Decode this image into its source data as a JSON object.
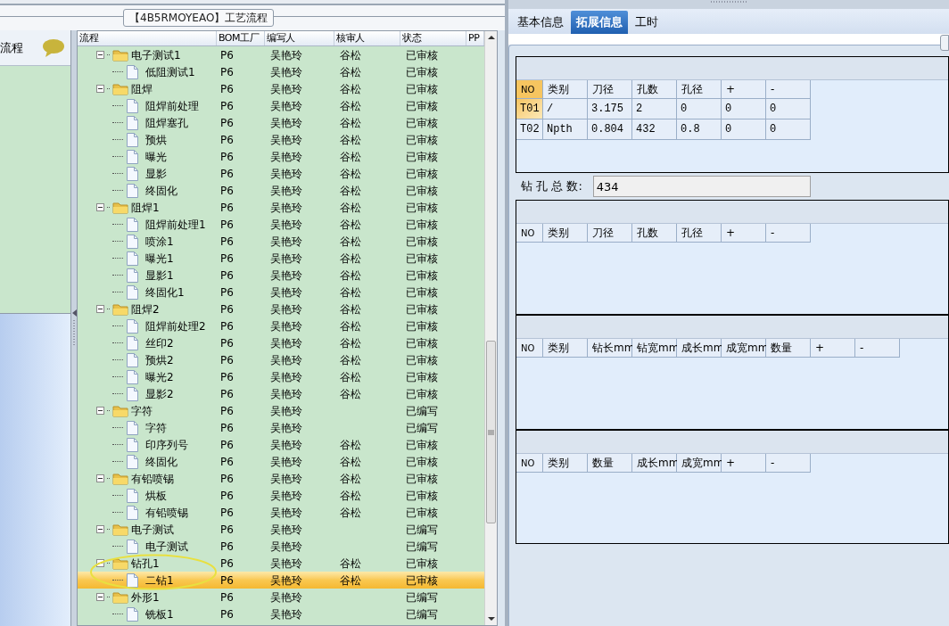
{
  "title_tab": "【4B5RMOYEAO】工艺流程",
  "left_panel": {
    "title": "流程"
  },
  "tree": {
    "columns": [
      "流程",
      "BOM工厂",
      "编写人",
      "核审人",
      "状态",
      "PP"
    ],
    "rows": [
      {
        "name": "电子测试1",
        "bom": "P6",
        "author": "吴艳玲",
        "reviewer": "谷松",
        "status": "已审核",
        "expanded": true,
        "selected": false,
        "children": [
          {
            "name": "低阻测试1",
            "bom": "P6",
            "author": "吴艳玲",
            "reviewer": "谷松",
            "status": "已审核",
            "selected": false
          }
        ]
      },
      {
        "name": "阻焊",
        "bom": "P6",
        "author": "吴艳玲",
        "reviewer": "谷松",
        "status": "已审核",
        "expanded": true,
        "selected": false,
        "children": [
          {
            "name": "阻焊前处理",
            "bom": "P6",
            "author": "吴艳玲",
            "reviewer": "谷松",
            "status": "已审核",
            "selected": false
          },
          {
            "name": "阻焊塞孔",
            "bom": "P6",
            "author": "吴艳玲",
            "reviewer": "谷松",
            "status": "已审核",
            "selected": false
          },
          {
            "name": "预烘",
            "bom": "P6",
            "author": "吴艳玲",
            "reviewer": "谷松",
            "status": "已审核",
            "selected": false
          },
          {
            "name": "曝光",
            "bom": "P6",
            "author": "吴艳玲",
            "reviewer": "谷松",
            "status": "已审核",
            "selected": false
          },
          {
            "name": "显影",
            "bom": "P6",
            "author": "吴艳玲",
            "reviewer": "谷松",
            "status": "已审核",
            "selected": false
          },
          {
            "name": "终固化",
            "bom": "P6",
            "author": "吴艳玲",
            "reviewer": "谷松",
            "status": "已审核",
            "selected": false
          }
        ]
      },
      {
        "name": "阻焊1",
        "bom": "P6",
        "author": "吴艳玲",
        "reviewer": "谷松",
        "status": "已审核",
        "expanded": true,
        "selected": false,
        "children": [
          {
            "name": "阻焊前处理1",
            "bom": "P6",
            "author": "吴艳玲",
            "reviewer": "谷松",
            "status": "已审核",
            "selected": false
          },
          {
            "name": "喷涂1",
            "bom": "P6",
            "author": "吴艳玲",
            "reviewer": "谷松",
            "status": "已审核",
            "selected": false
          },
          {
            "name": "曝光1",
            "bom": "P6",
            "author": "吴艳玲",
            "reviewer": "谷松",
            "status": "已审核",
            "selected": false
          },
          {
            "name": "显影1",
            "bom": "P6",
            "author": "吴艳玲",
            "reviewer": "谷松",
            "status": "已审核",
            "selected": false
          },
          {
            "name": "终固化1",
            "bom": "P6",
            "author": "吴艳玲",
            "reviewer": "谷松",
            "status": "已审核",
            "selected": false
          }
        ]
      },
      {
        "name": "阻焊2",
        "bom": "P6",
        "author": "吴艳玲",
        "reviewer": "谷松",
        "status": "已审核",
        "expanded": true,
        "selected": false,
        "children": [
          {
            "name": "阻焊前处理2",
            "bom": "P6",
            "author": "吴艳玲",
            "reviewer": "谷松",
            "status": "已审核",
            "selected": false
          },
          {
            "name": "丝印2",
            "bom": "P6",
            "author": "吴艳玲",
            "reviewer": "谷松",
            "status": "已审核",
            "selected": false
          },
          {
            "name": "预烘2",
            "bom": "P6",
            "author": "吴艳玲",
            "reviewer": "谷松",
            "status": "已审核",
            "selected": false
          },
          {
            "name": "曝光2",
            "bom": "P6",
            "author": "吴艳玲",
            "reviewer": "谷松",
            "status": "已审核",
            "selected": false
          },
          {
            "name": "显影2",
            "bom": "P6",
            "author": "吴艳玲",
            "reviewer": "谷松",
            "status": "已审核",
            "selected": false
          }
        ]
      },
      {
        "name": "字符",
        "bom": "P6",
        "author": "吴艳玲",
        "status": "已编写",
        "expanded": true,
        "selected": false,
        "children": [
          {
            "name": "字符",
            "bom": "P6",
            "author": "吴艳玲",
            "status": "已编写",
            "selected": false
          },
          {
            "name": "印序列号",
            "bom": "P6",
            "author": "吴艳玲",
            "reviewer": "谷松",
            "status": "已审核",
            "selected": false
          },
          {
            "name": "终固化",
            "bom": "P6",
            "author": "吴艳玲",
            "reviewer": "谷松",
            "status": "已审核",
            "selected": false
          }
        ]
      },
      {
        "name": "有铅喷锡",
        "bom": "P6",
        "author": "吴艳玲",
        "reviewer": "谷松",
        "status": "已审核",
        "expanded": true,
        "selected": false,
        "children": [
          {
            "name": "烘板",
            "bom": "P6",
            "author": "吴艳玲",
            "reviewer": "谷松",
            "status": "已审核",
            "selected": false
          },
          {
            "name": "有铅喷锡",
            "bom": "P6",
            "author": "吴艳玲",
            "reviewer": "谷松",
            "status": "已审核",
            "selected": false
          }
        ]
      },
      {
        "name": "电子测试",
        "bom": "P6",
        "author": "吴艳玲",
        "status": "已编写",
        "expanded": true,
        "selected": false,
        "children": [
          {
            "name": "电子测试",
            "bom": "P6",
            "author": "吴艳玲",
            "status": "已编写",
            "selected": false
          }
        ]
      },
      {
        "name": "钻孔1",
        "bom": "P6",
        "author": "吴艳玲",
        "reviewer": "谷松",
        "status": "已审核",
        "expanded": true,
        "selected": false,
        "children": [
          {
            "name": "二钻1",
            "bom": "P6",
            "author": "吴艳玲",
            "reviewer": "谷松",
            "status": "已审核",
            "selected": true
          }
        ]
      },
      {
        "name": "外形1",
        "bom": "P6",
        "author": "吴艳玲",
        "status": "已编写",
        "expanded": true,
        "selected": false,
        "children": [
          {
            "name": "铣板1",
            "bom": "P6",
            "author": "吴艳玲",
            "status": "已编写",
            "selected": false
          }
        ]
      }
    ]
  },
  "detail": {
    "tabs": [
      {
        "label": "基本信息",
        "selected": false
      },
      {
        "label": "拓展信息",
        "selected": true
      },
      {
        "label": "工时",
        "selected": false
      }
    ],
    "drill_table": {
      "columns": [
        "NO",
        "类别",
        "刀径",
        "孔数",
        "孔径",
        "+",
        "-"
      ],
      "rows": [
        {
          "cells": [
            "T01",
            "/",
            "3.175",
            "2",
            "0",
            "0",
            "0"
          ],
          "selected": true
        },
        {
          "cells": [
            "T02",
            "Npth",
            "0.804",
            "432",
            "0.8",
            "0",
            "0"
          ],
          "selected": false
        }
      ]
    },
    "total": {
      "label": "钻 孔 总 数:",
      "value": "434"
    },
    "table_2": {
      "columns": [
        "NO",
        "类别",
        "刀径",
        "孔数",
        "孔径",
        "+",
        "-"
      ]
    },
    "table_3": {
      "columns": [
        "NO",
        "类别",
        "钻长mm",
        "钻宽mm",
        "成长mm",
        "成宽mm",
        "数量",
        "+",
        "-"
      ]
    },
    "table_4": {
      "columns": [
        "NO",
        "类别",
        "数量",
        "成长mm",
        "成宽mm",
        "+",
        "-"
      ]
    }
  }
}
